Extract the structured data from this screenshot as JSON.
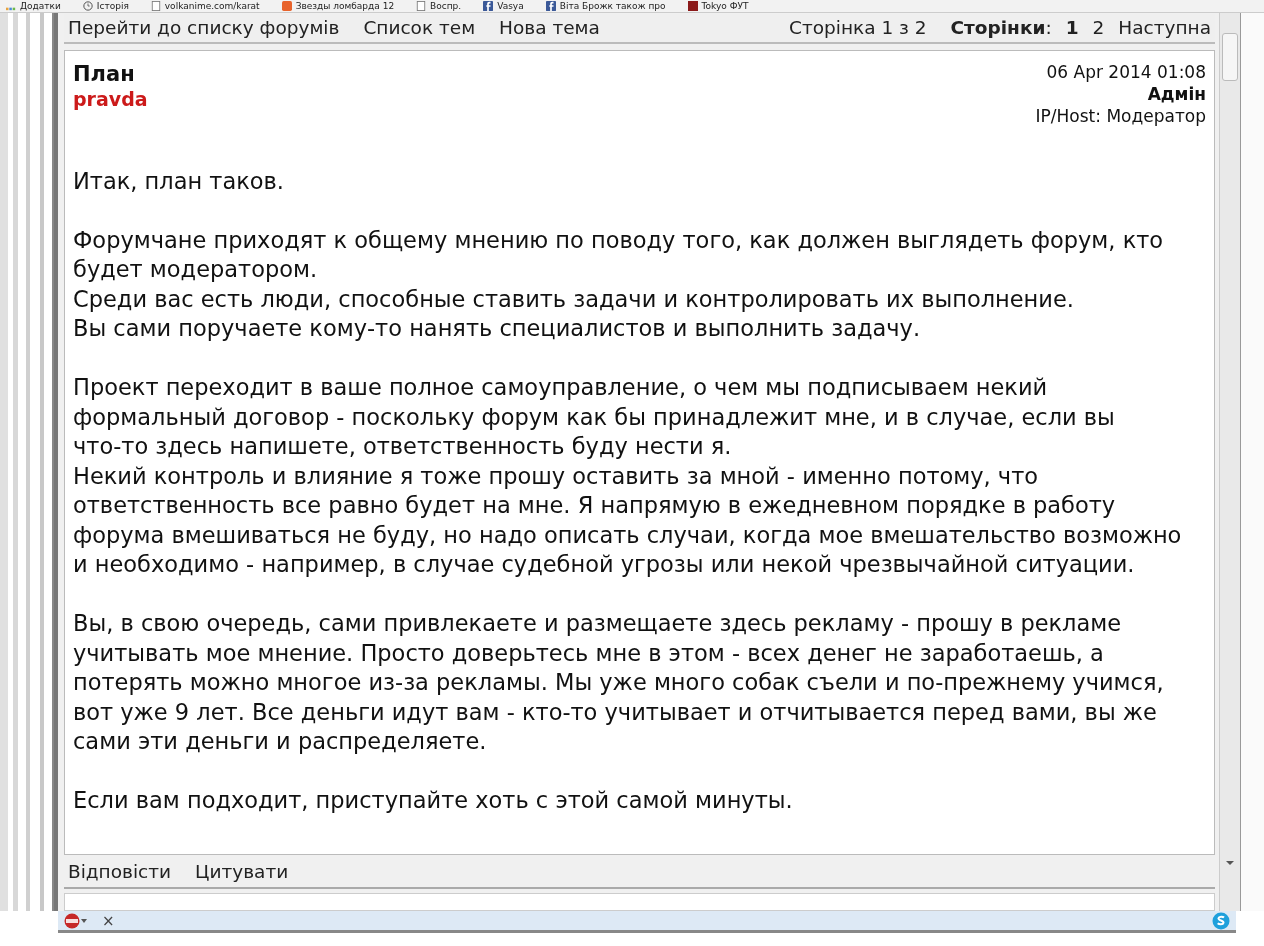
{
  "bookmarks_bar": {
    "items": [
      {
        "label": "Додатки",
        "kind": "apps"
      },
      {
        "label": "Історія",
        "kind": "history"
      },
      {
        "label": "volkanime.com/karat",
        "kind": "page"
      },
      {
        "label": "Звезды ломбарда 12",
        "kind": "site"
      },
      {
        "label": "Воспр.",
        "kind": "page"
      },
      {
        "label": "Vasya",
        "kind": "facebook"
      },
      {
        "label": "Віта Брожк також про",
        "kind": "facebook"
      },
      {
        "label": "Tokyo ФУТ",
        "kind": "favicon"
      }
    ]
  },
  "nav": {
    "links": [
      "Перейти до списку форумів",
      "Список тем",
      "Нова тема"
    ],
    "page_info": "Сторінка 1 з 2",
    "pages_label": "Сторінки",
    "pages_colon": ":",
    "pages": [
      {
        "label": "1",
        "selected": true
      },
      {
        "label": "2",
        "selected": false
      }
    ],
    "next": "Наступна"
  },
  "post": {
    "title": "План",
    "author": "pravda",
    "date": "06 Apr 2014 01:08",
    "role": "Адмін",
    "ip_host": "IP/Host: Модератор",
    "paragraphs": [
      [
        "Итак, план таков."
      ],
      [
        "Форумчане приходят к общему мнению по поводу того, как должен выглядеть форум, кто",
        "будет модератором.",
        "Среди вас есть люди, способные ставить задачи и контролировать их выполнение.",
        "Вы сами поручаете кому-то нанять специалистов и выполнить задачу."
      ],
      [
        "Проект переходит в ваше полное самоуправление, о чем мы подписываем некий",
        "формальный договор - поскольку форум как бы принадлежит мне, и в случае, если вы",
        "что-то здесь напишете, ответственность буду нести я.",
        "Некий контроль и влияние я тоже прошу оставить за мной - именно потому, что",
        "ответственность все равно будет на мне. Я напрямую в ежедневном порядке в работу",
        "форума вмешиваться не буду, но надо описать случаи, когда мое вмешательство возможно",
        "и необходимо - например, в случае судебной угрозы или некой чрезвычайной ситуации."
      ],
      [
        "Вы, в свою очередь, сами привлекаете и размещаете здесь рекламу - прошу в рекламе",
        "учитывать мое мнение. Просто доверьтесь мне в этом - всех денег не заработаешь, а",
        "потерять можно многое из-за рекламы. Мы уже много собак съели и по-прежнему учимся,",
        "вот уже 9 лет. Все деньги идут вам - кто-то учитывает и отчитывается перед вами, вы же",
        "сами эти деньги и распределяете."
      ],
      [
        "Если вам подходит, приступайте хоть с этой самой минуты."
      ]
    ],
    "actions": [
      "Відповісти",
      "Цитувати"
    ]
  },
  "addon_bar": {
    "close": "×"
  }
}
